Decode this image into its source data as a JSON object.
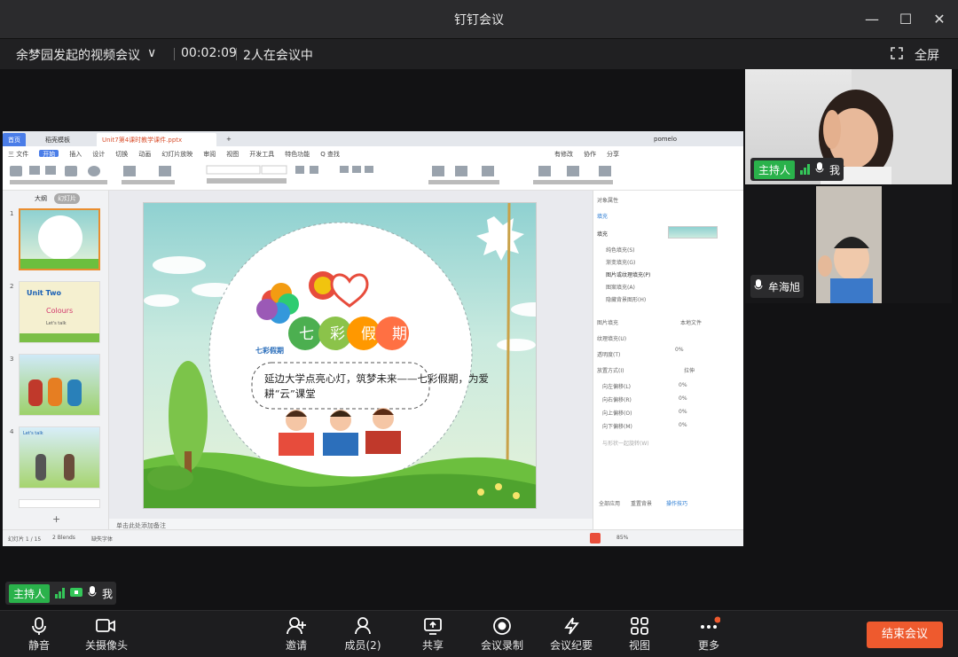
{
  "window": {
    "title": "钉钉会议",
    "minimize": "—",
    "maximize": "☐",
    "close": "✕"
  },
  "meeting": {
    "name": "余梦园发起的视频会议",
    "chevron": "∨",
    "duration": "00:02:09",
    "count": "2人在会议中",
    "fullscreen": "全屏"
  },
  "participants": [
    {
      "role": "主持人",
      "name": "我"
    },
    {
      "name": "牟海旭"
    }
  ],
  "self_strip": {
    "role": "主持人",
    "name": "我"
  },
  "toolbar": [
    {
      "label": "静音",
      "icon": "microphone-icon"
    },
    {
      "label": "关摄像头",
      "icon": "camera-icon"
    },
    {
      "label": "邀请",
      "icon": "add-person-icon"
    },
    {
      "label": "成员(2)",
      "icon": "members-icon"
    },
    {
      "label": "共享",
      "icon": "share-screen-icon"
    },
    {
      "label": "会议录制",
      "icon": "record-icon"
    },
    {
      "label": "会议纪要",
      "icon": "notes-icon"
    },
    {
      "label": "视图",
      "icon": "grid-view-icon"
    },
    {
      "label": "更多",
      "icon": "more-icon"
    }
  ],
  "end_button": "结束会议",
  "wps": {
    "tab_home": "首页",
    "tab_store": "稻壳模板",
    "tab_doc": "Unit7第4课时教学课件.pptx",
    "tab_add": "+",
    "user": "pomelo",
    "menu": [
      "三 文件",
      "开始",
      "插入",
      "设计",
      "切换",
      "动画",
      "幻灯片放映",
      "审阅",
      "视图",
      "开发工具",
      "特色功能",
      "Q 查找"
    ],
    "menu_right": [
      "有修改",
      "协作",
      "分享"
    ],
    "panel_tabs": [
      "大纲",
      "幻灯片"
    ],
    "thumbs": [
      {
        "num": "1",
        "title": ""
      },
      {
        "num": "2",
        "title": "Unit Two",
        "sub": "Colours",
        "note": "Let's talk"
      },
      {
        "num": "3",
        "title": ""
      },
      {
        "num": "4",
        "title": "Let's talk"
      }
    ],
    "notes_hint": "单击此处添加备注",
    "status": [
      "幻灯片 1 / 15",
      "2 Blends",
      "缺失字体"
    ],
    "zoom": "85%",
    "slide": {
      "heading": [
        "七",
        "彩",
        "假",
        "期"
      ],
      "logo_text": "七彩假期",
      "body": "延边大学点亮心灯，筑梦未来——七彩假期，为爱耕“云”课堂"
    },
    "prop": {
      "title": "对象属性",
      "tab": "填充",
      "section": "填充",
      "options": [
        "纯色填充(S)",
        "渐变填充(G)",
        "图片或纹理填充(P)",
        "图案填充(A)",
        "隐藏背景图形(H)"
      ],
      "fields": [
        {
          "label": "图片填充",
          "value": "本地文件"
        },
        {
          "label": "纹理填充(U)",
          "value": ""
        },
        {
          "label": "透明度(T)",
          "value": "0%"
        },
        {
          "label": "放置方式(I)",
          "value": "拉伸"
        },
        {
          "label": "向左偏移(L)",
          "value": "0%"
        },
        {
          "label": "向右偏移(R)",
          "value": "0%"
        },
        {
          "label": "向上偏移(O)",
          "value": "0%"
        },
        {
          "label": "向下偏移(M)",
          "value": "0%"
        }
      ],
      "rotate": "与形状一起旋转(W)",
      "apply_all": "全部应用",
      "reset": "重置背景",
      "tips": "操作技巧"
    }
  },
  "colors": {
    "host_badge": "#2ab24b",
    "end_button": "#ee5a2e",
    "signal": "#34c759"
  }
}
